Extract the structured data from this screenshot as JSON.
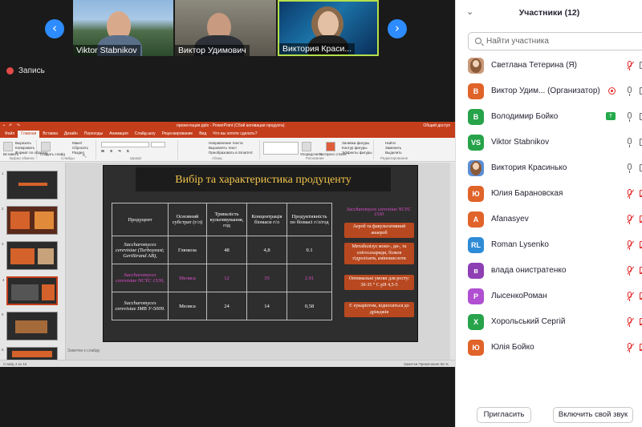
{
  "gallery": {
    "prev_arrow": "‹",
    "next_arrow": "›",
    "tiles": [
      {
        "name": "Viktor Stabnikov"
      },
      {
        "name": "Виктор Удимович"
      },
      {
        "name": "Виктория Краси..."
      }
    ]
  },
  "recording": {
    "label": "Запись"
  },
  "powerpoint": {
    "title_bar": "презентация.pptx - PowerPoint (Сбой активации продукта)",
    "share_label": "Общий доступ",
    "tabs": [
      "Файл",
      "Главная",
      "Вставка",
      "Дизайн",
      "Переходы",
      "Анимация",
      "Слайд-шоу",
      "Рецензирование",
      "Вид",
      "Что вы хотите сделать?"
    ],
    "ribbon": {
      "paste": "Вставить",
      "cut": "Вырезать",
      "copy": "Копировать",
      "format_painter": "Формат по образцу",
      "create_slide": "Создать слайд",
      "layout": "Макет",
      "reset": "Сбросить",
      "section": "Раздел",
      "find": "Найти",
      "replace": "Заменить",
      "select": "Выделить",
      "clipboard_group": "Буфер обмена",
      "slides_group": "Слайды",
      "font_group": "Шрифт",
      "paragraph_group": "Абзац",
      "drawing_group": "Рисование",
      "editing_group": "Редактирование",
      "arrange": "Упорядочить",
      "quick_styles": "Экспресс-стили",
      "shape_fill": "Заливка фигуры",
      "shape_outline": "Контур фигуры",
      "shape_effects": "Эффекты фигуры",
      "text_direction": "Направление текста",
      "align_text": "Выровнять текст",
      "smartart": "Преобразовать в SmartArt"
    },
    "notes_placeholder": "Заметки к слайду",
    "status_left": "Слайд 4 из 16",
    "status_right": "Заметки   Примечания   55 %",
    "slide": {
      "title": "Вибір та характеристика продуценту",
      "table_headers": [
        "Продуцент",
        "Основний субстрат (г/л)",
        "Тривалість культивування, год",
        "Концентрація біомаси г/л",
        "Продуктивність по біомасі г/л/год"
      ],
      "rows": [
        {
          "producer": "Saccharomyces cerevisiae (Turboyeast; GertStrand AB),",
          "substrate": "Глюкоза",
          "duration": "48",
          "concentration": "4,8",
          "productivity": "0.1",
          "highlight": false
        },
        {
          "producer": "Saccharomyces cerevisiae NCYC 1530,",
          "substrate": "Меляса",
          "duration": "12",
          "concentration": "35",
          "productivity": "2.91",
          "highlight": true
        },
        {
          "producer": "Saccharomyces cerevisiae IMB У-5009.",
          "substrate": "Меляса",
          "duration": "24",
          "concentration": "14",
          "productivity": "0,58",
          "highlight": false
        }
      ],
      "strain_heading": "Saccharomyces cerevisiae NCYC 1530",
      "info_boxes": [
        "Аероб та факультативний анаероб",
        "Метаболізує моно-, ди-, та олігосахариди, білков гідролізати, амінокислоти",
        "Оптимальні умови для росту: 30-35 ° С рН 4,5-5",
        "Є еукаріотом, відноситься до дріжджів"
      ]
    },
    "thumbnail_numbers": [
      "1",
      "2",
      "3",
      "4",
      "5",
      "6"
    ]
  },
  "participants_panel": {
    "title": "Участники (12)",
    "chevron": "⌄",
    "search_placeholder": "Найти участника",
    "participants": [
      {
        "name": "Светлана Тетерина (Я)",
        "initials": "",
        "color": "#c99a7a",
        "photo": true,
        "mic_muted": true,
        "cam_muted": false
      },
      {
        "name": "Виктор Удим... (Организатор)",
        "initials": "В",
        "color": "#e0632a",
        "photo": false,
        "mic_muted": false,
        "cam_muted": false,
        "recording": true
      },
      {
        "name": "Володимир Бойко",
        "initials": "В",
        "color": "#27a34a",
        "photo": false,
        "mic_muted": false,
        "cam_muted": false,
        "sharing": true
      },
      {
        "name": "Viktor Stabnikov",
        "initials": "VS",
        "color": "#27a34a",
        "photo": false,
        "mic_muted": false,
        "cam_muted": false
      },
      {
        "name": "Виктория Красинько",
        "initials": "",
        "color": "#5b8fd6",
        "photo": true,
        "mic_muted": false,
        "cam_muted": false
      },
      {
        "name": "Юлия Барановская",
        "initials": "Ю",
        "color": "#e0632a",
        "photo": false,
        "mic_muted": true,
        "cam_muted": true
      },
      {
        "name": "Afanasyev",
        "initials": "A",
        "color": "#e0632a",
        "photo": false,
        "mic_muted": true,
        "cam_muted": true
      },
      {
        "name": "Roman Lysenko",
        "initials": "RL",
        "color": "#2e8bd6",
        "photo": false,
        "mic_muted": true,
        "cam_muted": true
      },
      {
        "name": "влада онистратенко",
        "initials": "в",
        "color": "#8e3fb3",
        "photo": false,
        "mic_muted": true,
        "cam_muted": true
      },
      {
        "name": "ЛысенкоРоман",
        "initials": "Р",
        "color": "#b04fd1",
        "photo": false,
        "mic_muted": true,
        "cam_muted": true
      },
      {
        "name": "Хорольський Сергій",
        "initials": "Х",
        "color": "#27a34a",
        "photo": false,
        "mic_muted": true,
        "cam_muted": true
      },
      {
        "name": "Юлія Бойко",
        "initials": "Ю",
        "color": "#e0632a",
        "photo": false,
        "mic_muted": true,
        "cam_muted": true
      }
    ],
    "invite_label": "Пригласить",
    "unmute_all_label": "Включить свой звук"
  }
}
